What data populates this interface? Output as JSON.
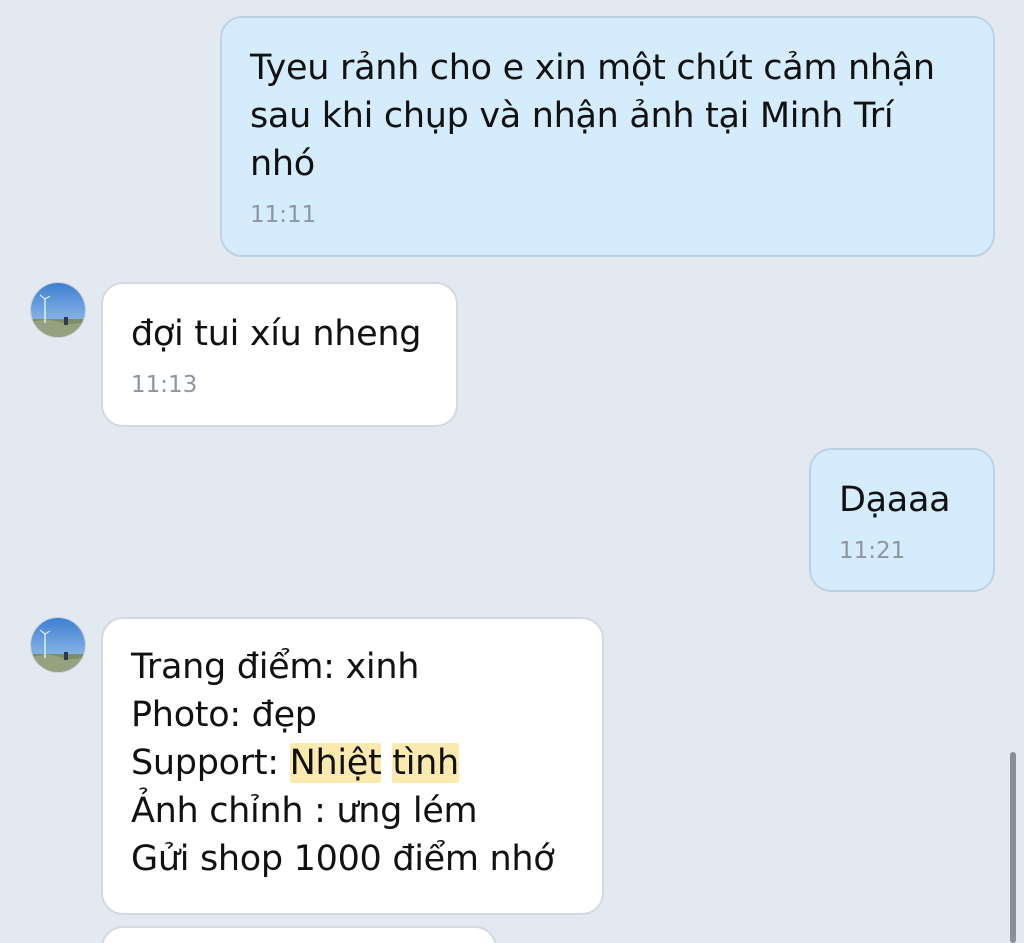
{
  "messages": [
    {
      "direction": "outgoing",
      "text": "Tyeu rảnh cho e xin một chút cảm nhận\nsau khi chụp và nhận ảnh tại Minh Trí\nnhó",
      "time": "11:11"
    },
    {
      "direction": "incoming",
      "text": "đợi tui xíu nheng",
      "time": "11:13"
    },
    {
      "direction": "outgoing",
      "text": "Dạaaa",
      "time": "11:21"
    },
    {
      "direction": "incoming",
      "lines": {
        "l1": "Trang điểm: xinh",
        "l2": "Photo: đẹp",
        "l3_prefix": "Support: ",
        "l3_hl1": "Nhiệt",
        "l3_hl2": "tình",
        "l4": "Ảnh chỉnh : ưng lém",
        "l5": "Gửi shop 1000 điểm nhớ"
      }
    }
  ],
  "avatar": {
    "icon": "landscape-avatar-icon",
    "colors": {
      "sky": "#4f8fd8",
      "ground": "#7d8c6a"
    }
  },
  "colors": {
    "background": "#e2e9f1",
    "outgoing_bubble": "#d5ecfc",
    "incoming_bubble": "#ffffff",
    "highlight": "#fbeab0",
    "timestamp": "#8d96a0"
  }
}
